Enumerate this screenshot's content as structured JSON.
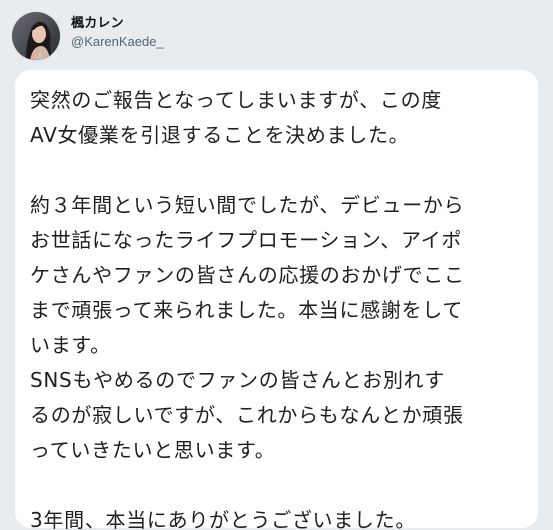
{
  "user": {
    "display_name": "楓カレン",
    "handle": "@KarenKaede_"
  },
  "tweet": {
    "lines": [
      "突然のご報告となってしまいますが、この度",
      "AV女優業を引退することを決めました。",
      "",
      "約３年間という短い間でしたが、デビューから",
      "お世話になったライフプロモーション、アイポ",
      "ケさんやファンの皆さんの応援のおかげでここ",
      "まで頑張って来られました。本当に感謝をして",
      "います。",
      "SNSもやめるのでファンの皆さんとお別れす",
      "るのが寂しいですが、これからもなんとか頑張",
      "っていきたいと思います。",
      "",
      "3年間、本当にありがとうございました。"
    ]
  },
  "colors": {
    "page_background": "#e9ecee",
    "card_background": "#ffffff",
    "name_text": "#0f1419",
    "handle_text": "#536471",
    "body_text": "#1e1f21"
  }
}
